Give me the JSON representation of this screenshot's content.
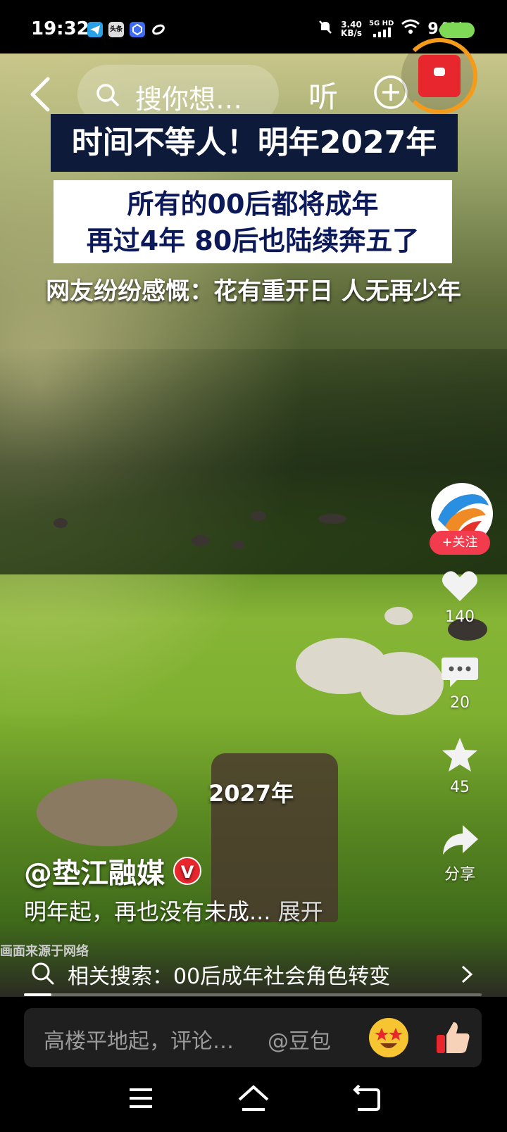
{
  "status_bar": {
    "time": "19:32",
    "app_icons": [
      "telegram-icon",
      "toutiao-icon",
      "app-blue-icon",
      "app-swirl-icon"
    ],
    "toutiao_label": "头条",
    "net_speed_value": "3.40",
    "net_speed_unit": "KB/s",
    "network_type": "5G HD",
    "battery_percent": "94%"
  },
  "top_bar": {
    "search_placeholder": "搜你想…",
    "listen_label": "听"
  },
  "video": {
    "caption_title": "时间不等人！明年2027年",
    "caption_line1": "所有的00后都将成年",
    "caption_line2": "再过4年 80后也陆续奔五了",
    "caption_subtitle": "网友纷纷感慨：花有重开日 人无再少年",
    "mid_label": "2027年",
    "source_note": "画面来源于网络"
  },
  "side_rail": {
    "follow_label": "+关注",
    "like_count": "140",
    "comment_count": "20",
    "favorite_count": "45",
    "share_label": "分享"
  },
  "post": {
    "author": "@垫江融媒",
    "verified_badge": "V",
    "description": "明年起，再也没有未成...",
    "expand_label": "展开"
  },
  "related_search": {
    "label": "相关搜索：00后成年社会角色转变"
  },
  "progress": {
    "played_fraction": 0.06
  },
  "comment_bar": {
    "placeholder": "高楼平地起，评论…",
    "mention_label": "@豆包"
  },
  "colors": {
    "follow_red": "#f23b4d",
    "caption_navy": "#0d1a3a",
    "redpack_ring": "#f59b1b",
    "battery_green": "#7ed957"
  }
}
